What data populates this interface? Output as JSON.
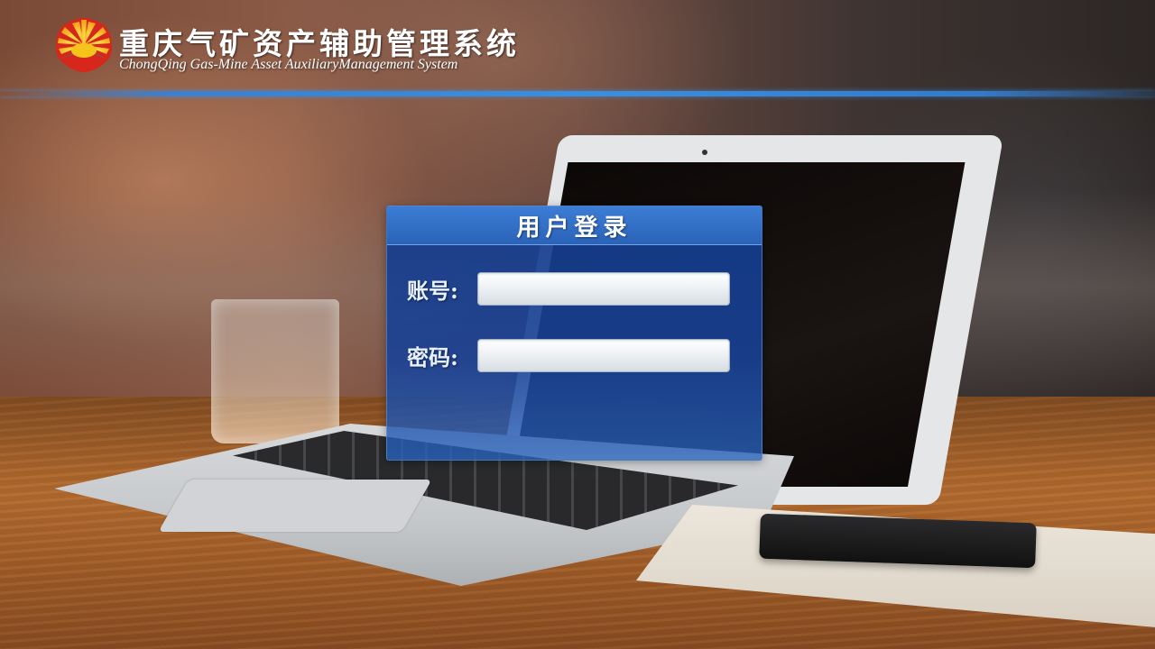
{
  "header": {
    "title_cn": "重庆气矿资产辅助管理系统",
    "title_en": "ChongQing Gas-Mine Asset AuxiliaryManagement System",
    "logo_icon": "petrochina-sun-icon"
  },
  "login": {
    "title": "用户登录",
    "account_label": "账号:",
    "account_value": "",
    "password_label": "密码:",
    "password_value": ""
  },
  "colors": {
    "accent_blue": "#3a8ee0",
    "panel_blue": "#1e4a9a",
    "logo_red": "#d7261c",
    "logo_yellow": "#f6c21c"
  }
}
